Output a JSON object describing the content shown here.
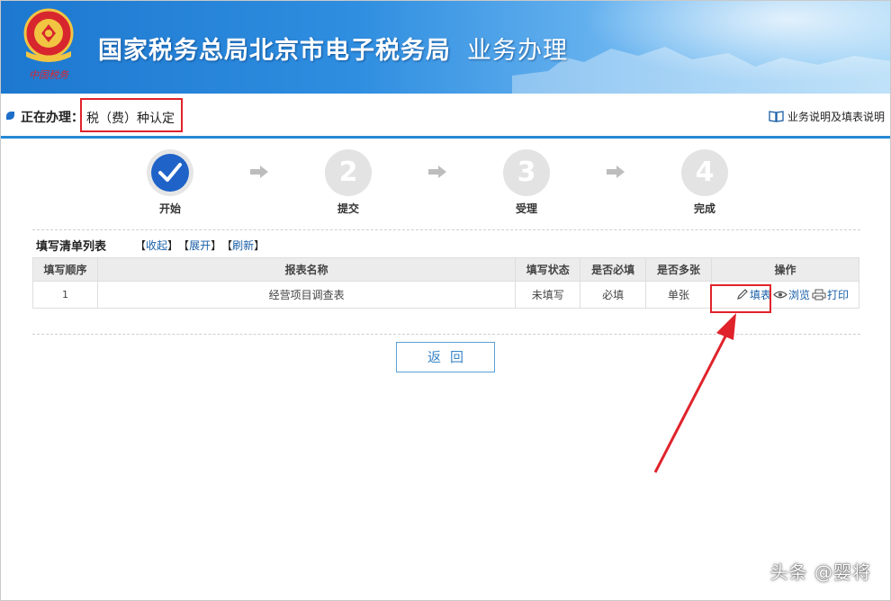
{
  "banner": {
    "title": "国家税务总局北京市电子税务局",
    "subtitle": "业务办理",
    "emblem_text": "中国税务"
  },
  "current": {
    "label": "正在办理：",
    "value": "税（费）种认定",
    "help_link": "业务说明及填表说明"
  },
  "steps": [
    {
      "label": "开始",
      "number": "",
      "state": "done"
    },
    {
      "label": "提交",
      "number": "2",
      "state": "pending"
    },
    {
      "label": "受理",
      "number": "3",
      "state": "pending"
    },
    {
      "label": "完成",
      "number": "4",
      "state": "pending"
    }
  ],
  "list": {
    "title": "填写清单列表",
    "collapse": "收起",
    "expand": "展开",
    "refresh": "刷新",
    "bracket_open": "【",
    "bracket_close": "】",
    "columns": [
      "填写顺序",
      "报表名称",
      "填写状态",
      "是否必填",
      "是否多张",
      "操作"
    ],
    "rows": [
      {
        "seq": "1",
        "name": "经营项目调查表",
        "status": "未填写",
        "required": "必填",
        "multiple": "单张",
        "actions": {
          "fill": "填表",
          "view": "浏览",
          "print": "打印"
        }
      }
    ]
  },
  "back_button": "返回",
  "watermark": "头条 @婴将",
  "colors": {
    "accent": "#1f63c8",
    "highlight": "#e0232b",
    "link": "#1a5fa8"
  }
}
